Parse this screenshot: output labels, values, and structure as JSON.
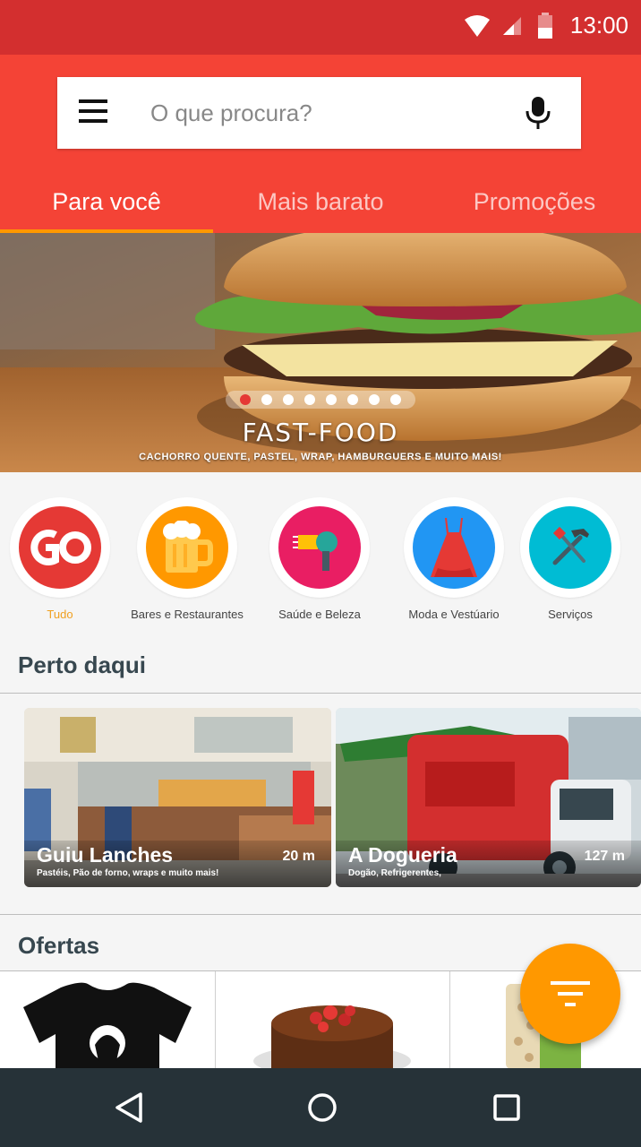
{
  "status_bar": {
    "time": "13:00",
    "icons": [
      "wifi-icon",
      "signal-icon",
      "battery-icon"
    ]
  },
  "search": {
    "placeholder": "O que procura?",
    "value": ""
  },
  "tabs": [
    {
      "label": "Para você",
      "active": true
    },
    {
      "label": "Mais barato",
      "active": false
    },
    {
      "label": "Promoções",
      "active": false
    }
  ],
  "banner": {
    "title": "FAST-FOOD",
    "subtitle": "CACHORRO QUENTE, PASTEL, WRAP, HAMBURGUERS E MUITO MAIS!",
    "dot_count": 8,
    "active_dot": 1
  },
  "categories": [
    {
      "label": "Tudo",
      "icon": "go-logo-icon",
      "color": "#e53935",
      "active": true
    },
    {
      "label": "Bares e Restaurantes",
      "icon": "beer-mug-icon",
      "color": "#ff9800",
      "active": false
    },
    {
      "label": "Saúde e Beleza",
      "icon": "hair-dryer-icon",
      "color": "#e91e63",
      "active": false
    },
    {
      "label": "Moda e Vestúario",
      "icon": "dress-icon",
      "color": "#2196f3",
      "active": false
    },
    {
      "label": "Serviços",
      "icon": "hammer-icon",
      "color": "#00bcd4",
      "active": false
    }
  ],
  "nearby": {
    "title": "Perto daqui",
    "places": [
      {
        "name": "Guiu Lanches",
        "description": "Pastéis, Pão de forno, wraps e muito mais!",
        "distance": "20 m"
      },
      {
        "name": "A Dogueria",
        "description": "Dogão, Refrigerentes,",
        "distance": "127 m"
      }
    ]
  },
  "offers": {
    "title": "Ofertas",
    "items": [
      "t-shirt-image",
      "chocolate-cake-image",
      "beans-package-image"
    ]
  },
  "colors": {
    "primary": "#f44336",
    "primary_dark": "#d32f2f",
    "accent": "#ff9800",
    "nav_bar": "#263238"
  },
  "nav": [
    "back-icon",
    "home-icon",
    "recents-icon"
  ]
}
